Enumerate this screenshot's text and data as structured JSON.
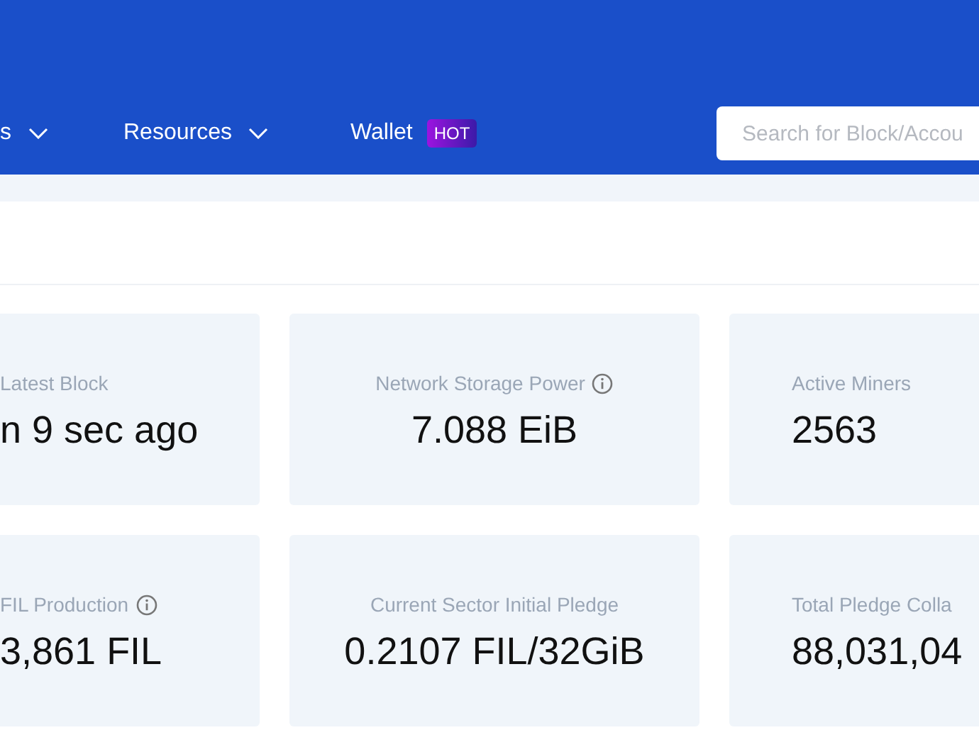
{
  "nav": {
    "items": [
      {
        "label": "s",
        "dropdown": true
      },
      {
        "label": "Resources",
        "dropdown": true
      },
      {
        "label": "Wallet",
        "dropdown": false,
        "badge": "HOT"
      }
    ]
  },
  "search": {
    "placeholder": "Search for Block/Accou"
  },
  "stats": [
    {
      "label": "Latest Block",
      "value": "n 9 sec ago",
      "info": false
    },
    {
      "label": "Network Storage Power",
      "value": "7.088 EiB",
      "info": true
    },
    {
      "label": "Active Miners",
      "value": "2563",
      "info": false
    },
    {
      "label": "FIL Production",
      "value": "3,861 FIL",
      "info": true
    },
    {
      "label": "Current Sector Initial Pledge",
      "value": "0.2107 FIL/32GiB",
      "info": false
    },
    {
      "label": "Total Pledge Colla",
      "value": "88,031,04",
      "info": false
    }
  ]
}
